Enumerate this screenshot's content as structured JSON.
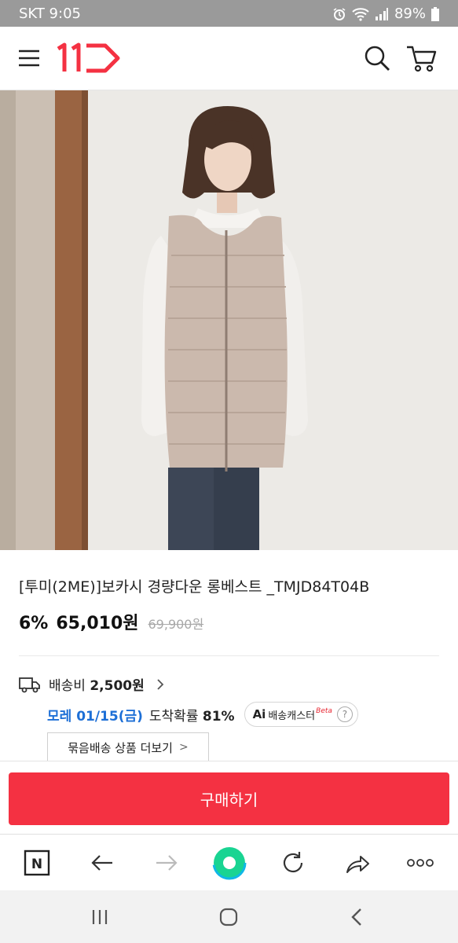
{
  "status_bar": {
    "carrier": "SKT 9:05",
    "battery": "89%"
  },
  "header": {
    "logo": "11",
    "icons": [
      "menu-icon",
      "search-icon",
      "cart-icon"
    ],
    "brand_color": "#f43142"
  },
  "product": {
    "title": "[투미(2ME)]보카시 경량다운 롱베스트 _TMJD84T04B",
    "discount": "6%",
    "price": "65,010원",
    "original_price": "69,900원"
  },
  "shipping": {
    "label": "배송비",
    "fee": "2,500원",
    "arrival_date": "모레 01/15(금)",
    "arrival_label": "도착확률",
    "arrival_rate": "81%",
    "ai_prefix": "Ai",
    "ai_label": "배송캐스터",
    "ai_beta": "Beta",
    "help": "?",
    "bundle_label": "묶음배송 상품 더보기",
    "bundle_chevron": ">"
  },
  "buy_button": {
    "label": "구매하기"
  },
  "browser_nav": {
    "n_label": "N",
    "icons": [
      "n-icon",
      "back-arrow-icon",
      "forward-arrow-icon",
      "home-circle-icon",
      "refresh-icon",
      "share-icon",
      "more-icon"
    ]
  },
  "system_nav": {
    "icons": [
      "recent-apps-icon",
      "home-icon",
      "back-icon"
    ]
  },
  "colors": {
    "accent": "#f43142",
    "link_blue": "#1d6fd6"
  }
}
